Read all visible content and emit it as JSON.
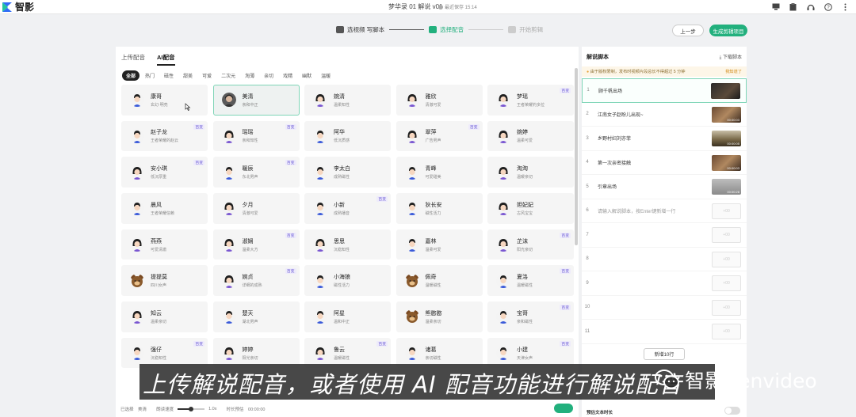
{
  "app": {
    "logo_text": "智影",
    "doc_title": "梦华录 01 解说 v01",
    "save_status": "最近保存 15:14"
  },
  "steps": [
    {
      "label": "选视频 写脚本",
      "state": "done"
    },
    {
      "label": "选择配音",
      "state": "active"
    },
    {
      "label": "开始剪辑",
      "state": "todo"
    }
  ],
  "buttons": {
    "prev": "上一步",
    "generate": "生成剪辑项目"
  },
  "voice_panel": {
    "tabs": [
      "上传配音",
      "AI配音"
    ],
    "active_tab": 1,
    "categories": [
      "全部",
      "热门",
      "磁性",
      "甜美",
      "可爱",
      "二次元",
      "淘薄",
      "亲切",
      "戏精",
      "幽默",
      "温暖"
    ],
    "active_category": 0,
    "voices": [
      {
        "name": "康哥",
        "desc": "玄幻·明亮",
        "badge": "",
        "avatar": "male"
      },
      {
        "name": "美清",
        "desc": "亲和中正",
        "badge": "",
        "avatar": "photo",
        "selected": true
      },
      {
        "name": "婉清",
        "desc": "温柔知性",
        "badge": "",
        "avatar": "female"
      },
      {
        "name": "雅欣",
        "desc": "清澈可爱",
        "badge": "",
        "avatar": "female"
      },
      {
        "name": "梦瑶",
        "desc": "王者荣耀钓多拉",
        "badge": "百变",
        "avatar": "female"
      },
      {
        "name": "赵子龙",
        "desc": "王者荣耀的赵云",
        "badge": "百变",
        "avatar": "male"
      },
      {
        "name": "瑶瑶",
        "desc": "亲和知性",
        "badge": "百变",
        "avatar": "female"
      },
      {
        "name": "阿华",
        "desc": "低沉质感",
        "badge": "",
        "avatar": "male"
      },
      {
        "name": "翠萍",
        "desc": "广告男声",
        "badge": "百变",
        "avatar": "female"
      },
      {
        "name": "婉婷",
        "desc": "温柔可爱",
        "badge": "",
        "avatar": "female"
      },
      {
        "name": "安小琪",
        "desc": "低沉厚重",
        "badge": "百变",
        "avatar": "female"
      },
      {
        "name": "暖辰",
        "desc": "东北男声",
        "badge": "百变",
        "avatar": "male"
      },
      {
        "name": "李太白",
        "desc": "成熟磁性",
        "badge": "",
        "avatar": "male"
      },
      {
        "name": "青峰",
        "desc": "可爱甜美",
        "badge": "",
        "avatar": "male"
      },
      {
        "name": "淘淘",
        "desc": "温暖亲切",
        "badge": "",
        "avatar": "female"
      },
      {
        "name": "晨风",
        "desc": "王者荣耀信赖",
        "badge": "",
        "avatar": "male"
      },
      {
        "name": "夕月",
        "desc": "清澈可爱",
        "badge": "",
        "avatar": "female"
      },
      {
        "name": "小新",
        "desc": "成熟播音",
        "badge": "百变",
        "avatar": "male"
      },
      {
        "name": "狄长安",
        "desc": "磁性活力",
        "badge": "",
        "avatar": "male"
      },
      {
        "name": "妲妃妃",
        "desc": "古风宝宝",
        "badge": "",
        "avatar": "female"
      },
      {
        "name": "燕燕",
        "desc": "可爱清澈",
        "badge": "",
        "avatar": "female"
      },
      {
        "name": "淑娴",
        "desc": "温柔大方",
        "badge": "百变",
        "avatar": "female"
      },
      {
        "name": "思思",
        "desc": "沉稳知性",
        "badge": "",
        "avatar": "female"
      },
      {
        "name": "嘉林",
        "desc": "温柔可爱",
        "badge": "",
        "avatar": "male"
      },
      {
        "name": "芷沫",
        "desc": "阳光亲切",
        "badge": "百变",
        "avatar": "female"
      },
      {
        "name": "提提莫",
        "desc": "四川女声",
        "badge": "",
        "avatar": "bear"
      },
      {
        "name": "婉贞",
        "desc": "详细的成熟",
        "badge": "百变",
        "avatar": "female"
      },
      {
        "name": "小海狼",
        "desc": "磁性活力",
        "badge": "",
        "avatar": "male"
      },
      {
        "name": "佩奇",
        "desc": "温暖磁性",
        "badge": "",
        "avatar": "bear"
      },
      {
        "name": "夏洛",
        "desc": "温暖磁性",
        "badge": "百变",
        "avatar": "male"
      },
      {
        "name": "知云",
        "desc": "温柔亲切",
        "badge": "",
        "avatar": "female"
      },
      {
        "name": "楚天",
        "desc": "湖北男声",
        "badge": "",
        "avatar": "male"
      },
      {
        "name": "阿星",
        "desc": "温和中正",
        "badge": "",
        "avatar": "male"
      },
      {
        "name": "熊憨憨",
        "desc": "温柔亲切",
        "badge": "",
        "avatar": "bear"
      },
      {
        "name": "宝哥",
        "desc": "亲和磁性",
        "badge": "百变",
        "avatar": "male"
      },
      {
        "name": "强仔",
        "desc": "沉稳知性",
        "badge": "百变",
        "avatar": "male"
      },
      {
        "name": "婷婷",
        "desc": "阳光亲切",
        "badge": "",
        "avatar": "female"
      },
      {
        "name": "鲁云",
        "desc": "温暖磁性",
        "badge": "百变",
        "avatar": "female"
      },
      {
        "name": "诸葛",
        "desc": "亲切磁性",
        "badge": "",
        "avatar": "male"
      },
      {
        "name": "小建",
        "desc": "天津女声",
        "badge": "百变",
        "avatar": "male"
      }
    ],
    "footer": {
      "selected_label": "已选择",
      "selected_value": "美清",
      "speed_label": "朗读速度",
      "speed_value": "1.0x",
      "speed_level": 0.5,
      "duration_label": "时长预估",
      "duration_value": "00:00:00"
    }
  },
  "script_panel": {
    "title": "解说脚本",
    "download": "下载脚本",
    "notice": "由于版权限制，发布时视频片段总长不得超过 5 分钟",
    "notice_link": "我知道了",
    "rows": [
      {
        "num": "1",
        "text": "顾千帆出场",
        "thumb": "dark",
        "duration": ""
      },
      {
        "num": "2",
        "text": "江南女子赵盼儿出现~",
        "thumb": "warm",
        "duration": "00:00:03"
      },
      {
        "num": "3",
        "text": "乡野村妇刘亦菲",
        "thumb": "outdoor",
        "duration": "00:00:05"
      },
      {
        "num": "4",
        "text": "第一次亲密接触",
        "thumb": "warm",
        "duration": "00:00:03"
      },
      {
        "num": "5",
        "text": "引章出场",
        "thumb": "gray",
        "duration": "00:00:28"
      },
      {
        "num": "6",
        "text": "请输入解说脚本，按Enter键新增一行",
        "placeholder": true
      },
      {
        "num": "7",
        "text": ""
      },
      {
        "num": "8",
        "text": ""
      },
      {
        "num": "9",
        "text": ""
      },
      {
        "num": "10",
        "text": ""
      },
      {
        "num": "11",
        "text": ""
      }
    ],
    "empty_thumb_label": "+00",
    "add_rows": "新增10行",
    "footer_label": "预估文本时长"
  },
  "overlay": {
    "subtitle": "上传解说配音，或者使用 AI 配音功能进行解说配音",
    "watermark": "智影Zenvideo"
  },
  "colors": {
    "accent": "#22b07d",
    "badge": "#6b5bd6"
  }
}
